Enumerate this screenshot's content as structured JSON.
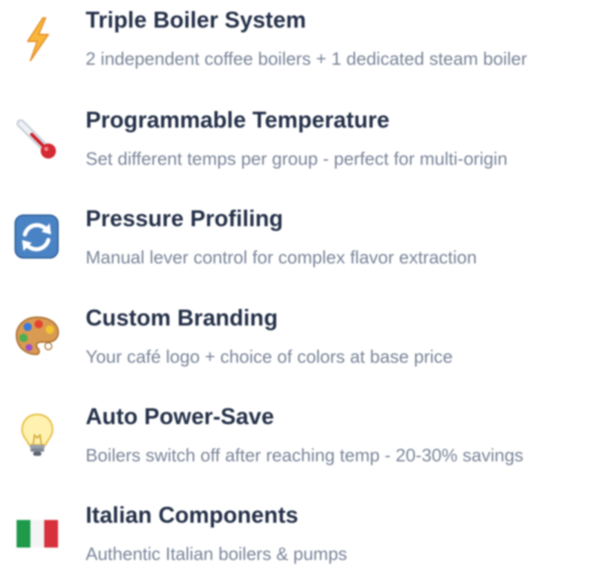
{
  "features": [
    {
      "icon": "lightning-icon",
      "title": "Triple Boiler System",
      "description": "2 independent coffee boilers + 1 dedicated steam boiler"
    },
    {
      "icon": "thermometer-icon",
      "title": "Programmable Temperature",
      "description": "Set different temps per group - perfect for multi-origin"
    },
    {
      "icon": "cycle-arrows-icon",
      "title": "Pressure Profiling",
      "description": "Manual lever control for complex flavor extraction"
    },
    {
      "icon": "palette-icon",
      "title": "Custom Branding",
      "description": "Your café logo + choice of colors at base price"
    },
    {
      "icon": "lightbulb-icon",
      "title": "Auto Power-Save",
      "description": "Boilers switch off after reaching temp - 20-30% savings"
    },
    {
      "icon": "italy-flag-icon",
      "title": "Italian Components",
      "description": "Authentic Italian boilers & pumps"
    }
  ],
  "colors": {
    "title": "#26324a",
    "description": "#7a8599"
  }
}
